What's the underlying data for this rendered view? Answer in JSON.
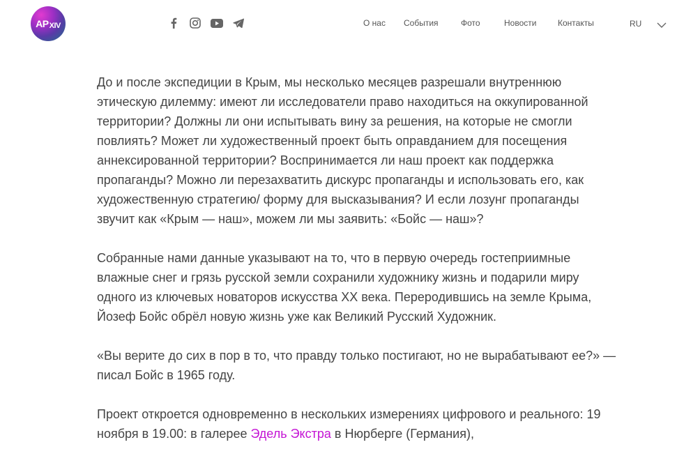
{
  "logo": {
    "line1": "AP",
    "line2": "XIV"
  },
  "social": [
    {
      "icon": "facebook-icon"
    },
    {
      "icon": "instagram-icon"
    },
    {
      "icon": "youtube-icon"
    },
    {
      "icon": "telegram-icon"
    }
  ],
  "nav": {
    "about": "О нас",
    "events": "События",
    "photo": "Фото",
    "news": "Новости",
    "contacts": "Контакты"
  },
  "language": {
    "current": "RU"
  },
  "article": {
    "p1": "До и после экспедиции в Крым, мы несколько месяцев разрешали внутреннюю этическую дилемму: имеют ли исследователи право находиться на оккупированной территории? Должны ли они испытывать вину за решения, на которые не смогли повлиять? Может ли художественный проект быть оправданием для посещения аннексированной территории? Воспринимается ли наш проект как поддержка пропаганды? Можно ли перезахватить дискурс пропаганды и использовать его, как художественную стратегию/ форму для высказывания? И если лозунг пропаганды звучит как «Крым — наш», можем ли мы заявить: «Бойс — наш»?",
    "p2": "Собранные нами данные указывают на то, что в первую очередь гостеприимные влажные снег и грязь русской земли сохранили художнику жизнь и подарили миру одного из ключевых новаторов искусства XX века. Переродившись на земле Крыма, Йозеф Бойс обрёл новую жизнь уже как Великий Русский Художник.",
    "p3": "«Вы верите до сих в пор в то, что правду только постигают, но не вырабатывают ее?» — писал Бойс в 1965 году.",
    "p4_before": "Проект откроется одновременно в нескольких измерениях цифрового и реального: 19 ноября в 19.00: в галерее ",
    "p4_link": "Эдель Экстра",
    "p4_after": " в Нюрберге (Германия),"
  },
  "colors": {
    "link": "#c414d4",
    "text": "#444444"
  }
}
